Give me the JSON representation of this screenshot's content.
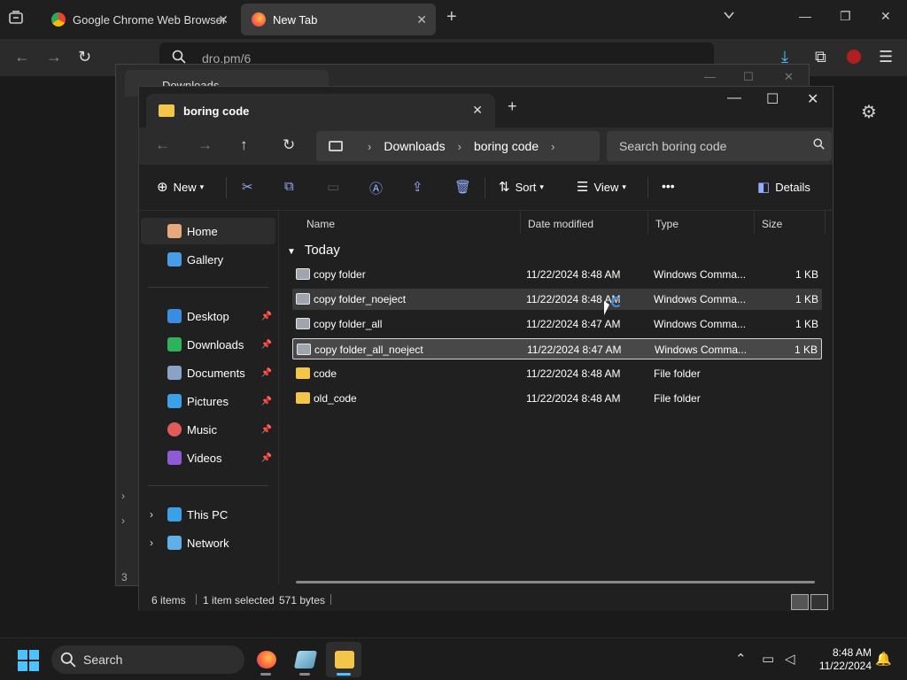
{
  "browser": {
    "tabs": [
      {
        "title": "Google Chrome Web Browser",
        "favicon": "chrome-icon"
      },
      {
        "title": "New Tab",
        "favicon": "firefox-icon"
      }
    ],
    "url": "dro.pm/6"
  },
  "bg_window": {
    "tab_title": "Downloads",
    "side_count": "3"
  },
  "explorer": {
    "tab_title": "boring code",
    "breadcrumb": [
      "Downloads",
      "boring code"
    ],
    "search_placeholder": "Search boring code",
    "commands": {
      "new": "New",
      "sort": "Sort",
      "view": "View",
      "more": "•••",
      "details": "Details"
    },
    "nav": {
      "quick": [
        {
          "label": "Home",
          "icon": "home-icon"
        },
        {
          "label": "Gallery",
          "icon": "gallery-icon"
        }
      ],
      "pinned": [
        {
          "label": "Desktop",
          "icon": "desktop-icon"
        },
        {
          "label": "Downloads",
          "icon": "downloads-icon"
        },
        {
          "label": "Documents",
          "icon": "documents-icon"
        },
        {
          "label": "Pictures",
          "icon": "pictures-icon"
        },
        {
          "label": "Music",
          "icon": "music-icon"
        },
        {
          "label": "Videos",
          "icon": "videos-icon"
        }
      ],
      "devices": [
        {
          "label": "This PC",
          "icon": "pc-icon"
        },
        {
          "label": "Network",
          "icon": "network-icon"
        }
      ]
    },
    "columns": [
      "Name",
      "Date modified",
      "Type",
      "Size"
    ],
    "group": "Today",
    "files": [
      {
        "name": "copy folder",
        "date": "11/22/2024 8:48 AM",
        "type": "Windows Comma...",
        "size": "1 KB",
        "kind": "cmd"
      },
      {
        "name": "copy folder_noeject",
        "date": "11/22/2024 8:48 AM",
        "type": "Windows Comma...",
        "size": "1 KB",
        "kind": "cmd"
      },
      {
        "name": "copy folder_all",
        "date": "11/22/2024 8:47 AM",
        "type": "Windows Comma...",
        "size": "1 KB",
        "kind": "cmd"
      },
      {
        "name": "copy folder_all_noeject",
        "date": "11/22/2024 8:47 AM",
        "type": "Windows Comma...",
        "size": "1 KB",
        "kind": "cmd"
      },
      {
        "name": "code",
        "date": "11/22/2024 8:48 AM",
        "type": "File folder",
        "size": "",
        "kind": "folder"
      },
      {
        "name": "old_code",
        "date": "11/22/2024 8:48 AM",
        "type": "File folder",
        "size": "",
        "kind": "folder"
      }
    ],
    "status": {
      "items": "6 items",
      "selected": "1 item selected",
      "size": "571 bytes"
    }
  },
  "taskbar": {
    "search": "Search",
    "time": "8:48 AM",
    "date": "11/22/2024"
  },
  "colors": {
    "accent": "#4cc2ff",
    "folder": "#f3c64a",
    "cmd_icon": "#8fb0ff"
  }
}
